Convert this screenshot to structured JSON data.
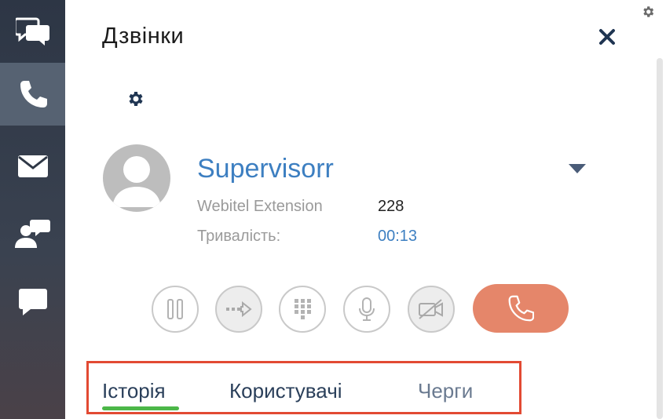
{
  "sidebar": {
    "items": [
      {
        "icon": "chat-bubbles-icon"
      },
      {
        "icon": "phone-icon",
        "active": true
      },
      {
        "icon": "envelope-icon"
      },
      {
        "icon": "user-chat-icon"
      },
      {
        "icon": "comment-icon"
      }
    ]
  },
  "panel": {
    "title": "Дзвінки",
    "close_icon": "close-icon",
    "settings_icon": "gear-icon"
  },
  "call": {
    "caller_name": "Supervisorr",
    "extension_label": "Webitel Extension",
    "extension_value": "228",
    "duration_label": "Тривалість:",
    "duration_value": "00:13"
  },
  "controls": [
    "pause-icon",
    "transfer-icon",
    "keypad-icon",
    "microphone-icon",
    "video-off-icon",
    "hangup-icon"
  ],
  "tabs": [
    {
      "label": "Історія",
      "active": true
    },
    {
      "label": "Користувачі"
    },
    {
      "label": "Черги"
    }
  ],
  "colors": {
    "accent_blue": "#3d7fc1",
    "hangup": "#e5866a",
    "tab_active_underline": "#4cb748",
    "highlight_box": "#e24a33",
    "sidebar_bg": "#2d3645",
    "sidebar_active": "#566272"
  }
}
